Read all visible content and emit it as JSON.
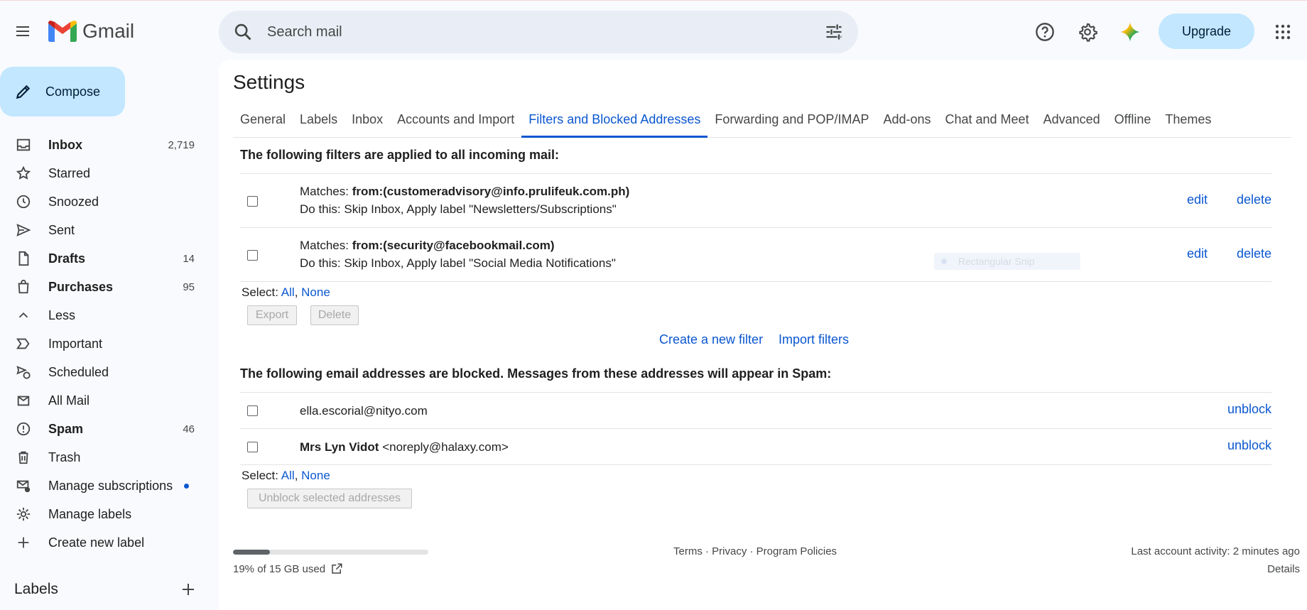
{
  "app": {
    "name": "Gmail"
  },
  "search": {
    "placeholder": "Search mail"
  },
  "header": {
    "upgrade_label": "Upgrade"
  },
  "compose": {
    "label": "Compose"
  },
  "sidebar": {
    "items": [
      {
        "label": "Inbox",
        "count": "2,719",
        "icon": "inbox-icon",
        "bold": true
      },
      {
        "label": "Starred",
        "count": "",
        "icon": "star-icon"
      },
      {
        "label": "Snoozed",
        "count": "",
        "icon": "clock-icon"
      },
      {
        "label": "Sent",
        "count": "",
        "icon": "send-icon"
      },
      {
        "label": "Drafts",
        "count": "14",
        "icon": "draft-icon",
        "bold": true
      },
      {
        "label": "Purchases",
        "count": "95",
        "icon": "shopping-bag-icon",
        "bold": true
      },
      {
        "label": "Less",
        "count": "",
        "icon": "chevron-up-icon"
      },
      {
        "label": "Important",
        "count": "",
        "icon": "label-important-icon"
      },
      {
        "label": "Scheduled",
        "count": "",
        "icon": "scheduled-send-icon"
      },
      {
        "label": "All Mail",
        "count": "",
        "icon": "all-mail-icon"
      },
      {
        "label": "Spam",
        "count": "46",
        "icon": "spam-icon",
        "bold": true
      },
      {
        "label": "Trash",
        "count": "",
        "icon": "trash-icon"
      },
      {
        "label": "Manage subscriptions",
        "count": "",
        "icon": "manage-subscriptions-icon"
      },
      {
        "label": "Manage labels",
        "count": "",
        "icon": "settings-icon"
      },
      {
        "label": "Create new label",
        "count": "",
        "icon": "plus-icon"
      }
    ],
    "labels_header": "Labels"
  },
  "settings": {
    "title": "Settings",
    "tabs": [
      "General",
      "Labels",
      "Inbox",
      "Accounts and Import",
      "Filters and Blocked Addresses",
      "Forwarding and POP/IMAP",
      "Add-ons",
      "Chat and Meet",
      "Advanced",
      "Offline",
      "Themes"
    ],
    "active_tab": "Filters and Blocked Addresses",
    "filters_header": "The following filters are applied to all incoming mail:",
    "filters": [
      {
        "matches_prefix": "Matches: ",
        "matches": "from:(customeradvisory@info.prulifeuk.com.ph)",
        "action": "Do this: Skip Inbox, Apply label \"Newsletters/Subscriptions\"",
        "edit": "edit",
        "delete": "delete"
      },
      {
        "matches_prefix": "Matches: ",
        "matches": "from:(security@facebookmail.com)",
        "action": "Do this: Skip Inbox, Apply label \"Social Media Notifications\"",
        "edit": "edit",
        "delete": "delete"
      }
    ],
    "select_label": "Select:",
    "select_all": "All",
    "select_none": "None",
    "export_label": "Export",
    "delete_label": "Delete",
    "create_filter": "Create a new filter",
    "import_filters": "Import filters",
    "blocked_header": "The following email addresses are blocked. Messages from these addresses will appear in Spam:",
    "blocked": [
      {
        "name": "",
        "email": "ella.escorial@nityo.com",
        "action": "unblock"
      },
      {
        "name": "Mrs Lyn Vidot",
        "email": "<noreply@halaxy.com>",
        "action": "unblock"
      }
    ],
    "unblock_selected": "Unblock selected addresses"
  },
  "overlay": {
    "snip_label": "Rectangular Snip"
  },
  "footer": {
    "storage_text": "19% of 15 GB used",
    "storage_fraction": 0.19,
    "links": "Terms · Privacy · Program Policies",
    "activity": "Last account activity: 2 minutes ago",
    "details": "Details"
  },
  "colors": {
    "accent": "#0b57d0",
    "compose_bg": "#c2e7ff",
    "search_bg": "#e9eef6"
  }
}
